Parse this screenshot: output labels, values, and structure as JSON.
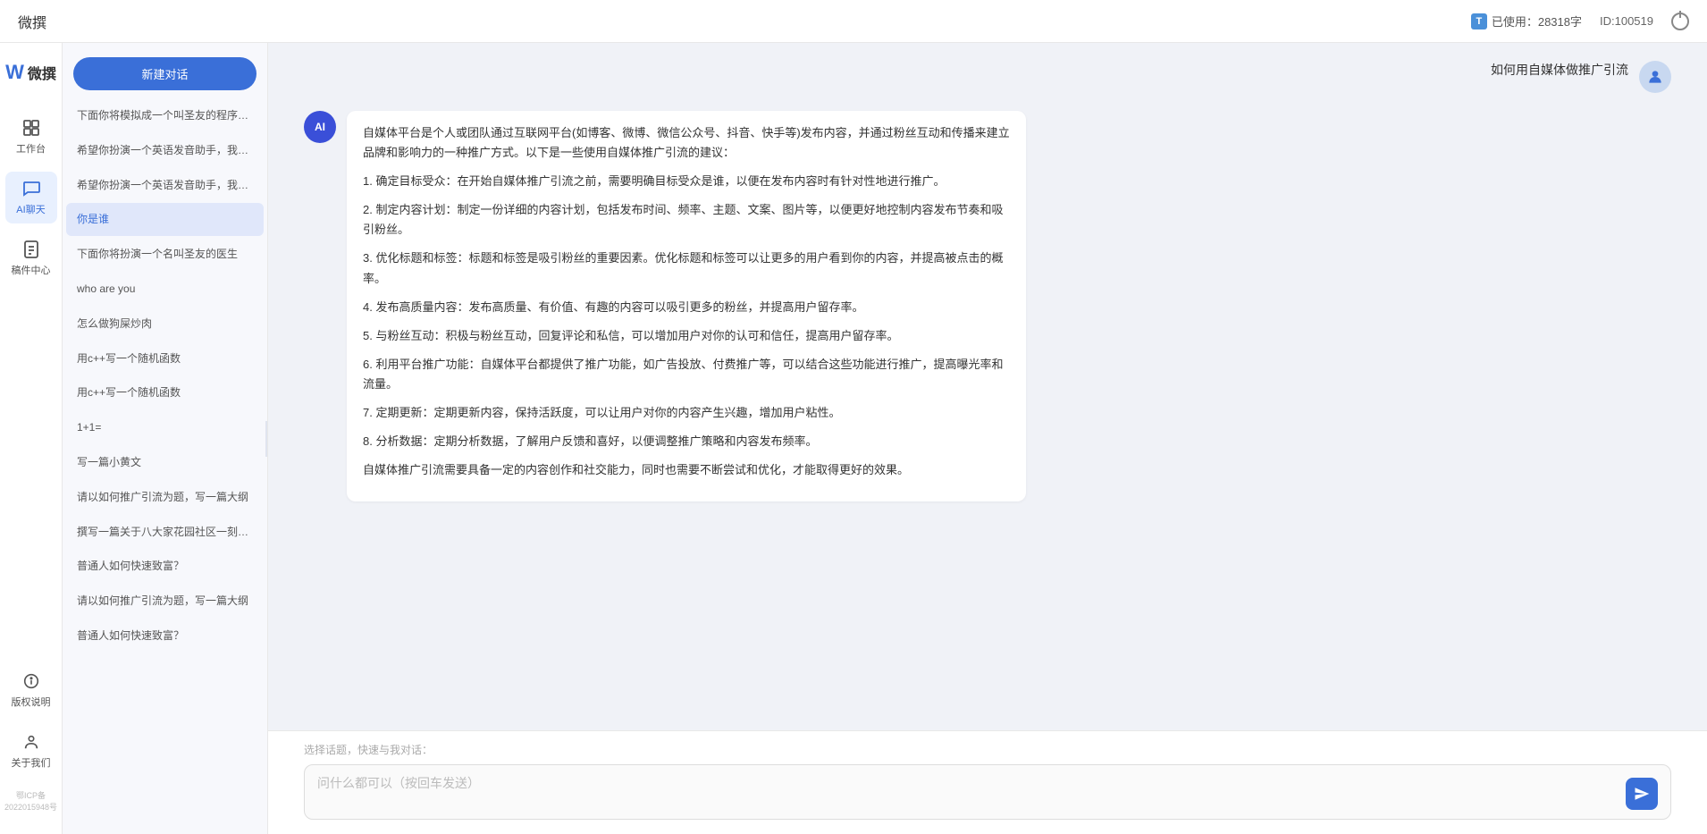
{
  "topbar": {
    "title": "微撰",
    "usage_label": "已使用：28318字",
    "id_label": "ID:100519"
  },
  "logo": {
    "w": "W",
    "text": "微撰"
  },
  "nav": {
    "items": [
      {
        "id": "workbench",
        "label": "工作台",
        "icon": "grid"
      },
      {
        "id": "ai-chat",
        "label": "AI聊天",
        "icon": "chat",
        "active": true
      },
      {
        "id": "drafts",
        "label": "稿件中心",
        "icon": "doc"
      }
    ],
    "bottom": [
      {
        "id": "copyright",
        "label": "版权说明",
        "icon": "info"
      },
      {
        "id": "about",
        "label": "关于我们",
        "icon": "about"
      }
    ],
    "icp": "鄂ICP备2022015948号"
  },
  "history": {
    "new_chat": "新建对话",
    "items": [
      {
        "id": 1,
        "text": "下面你将模拟成一个叫圣友的程序员，我说..."
      },
      {
        "id": 2,
        "text": "希望你扮演一个英语发音助手，我提供给你..."
      },
      {
        "id": 3,
        "text": "希望你扮演一个英语发音助手，我提供给你..."
      },
      {
        "id": 4,
        "text": "你是谁",
        "active": true
      },
      {
        "id": 5,
        "text": "下面你将扮演一个名叫圣友的医生"
      },
      {
        "id": 6,
        "text": "who are you"
      },
      {
        "id": 7,
        "text": "怎么做狗屎炒肉"
      },
      {
        "id": 8,
        "text": "用c++写一个随机函数"
      },
      {
        "id": 9,
        "text": "用c++写一个随机函数"
      },
      {
        "id": 10,
        "text": "1+1="
      },
      {
        "id": 11,
        "text": "写一篇小黄文"
      },
      {
        "id": 12,
        "text": "请以如何推广引流为题，写一篇大纲"
      },
      {
        "id": 13,
        "text": "撰写一篇关于八大家花园社区一刻钟便民生..."
      },
      {
        "id": 14,
        "text": "普通人如何快速致富？"
      },
      {
        "id": 15,
        "text": "请以如何推广引流为题，写一篇大纲"
      },
      {
        "id": 16,
        "text": "普通人如何快速致富？"
      }
    ]
  },
  "chat": {
    "user_question": "如何用自媒体做推广引流",
    "ai_response_paragraphs": [
      "自媒体平台是个人或团队通过互联网平台(如博客、微博、微信公众号、抖音、快手等)发布内容，并通过粉丝互动和传播来建立品牌和影响力的一种推广方式。以下是一些使用自媒体推广引流的建议：",
      "1. 确定目标受众：在开始自媒体推广引流之前，需要明确目标受众是谁，以便在发布内容时有针对性地进行推广。",
      "2. 制定内容计划：制定一份详细的内容计划，包括发布时间、频率、主题、文案、图片等，以便更好地控制内容发布节奏和吸引粉丝。",
      "3. 优化标题和标签：标题和标签是吸引粉丝的重要因素。优化标题和标签可以让更多的用户看到你的内容，并提高被点击的概率。",
      "4. 发布高质量内容：发布高质量、有价值、有趣的内容可以吸引更多的粉丝，并提高用户留存率。",
      "5. 与粉丝互动：积极与粉丝互动，回复评论和私信，可以增加用户对你的认可和信任，提高用户留存率。",
      "6. 利用平台推广功能：自媒体平台都提供了推广功能，如广告投放、付费推广等，可以结合这些功能进行推广，提高曝光率和流量。",
      "7. 定期更新：定期更新内容，保持活跃度，可以让用户对你的内容产生兴趣，增加用户粘性。",
      "8. 分析数据：定期分析数据，了解用户反馈和喜好，以便调整推广策略和内容发布频率。",
      "自媒体推广引流需要具备一定的内容创作和社交能力，同时也需要不断尝试和优化，才能取得更好的效果。"
    ]
  },
  "input": {
    "quick_label": "选择话题，快速与我对话：",
    "placeholder": "问什么都可以（按回车发送）"
  }
}
